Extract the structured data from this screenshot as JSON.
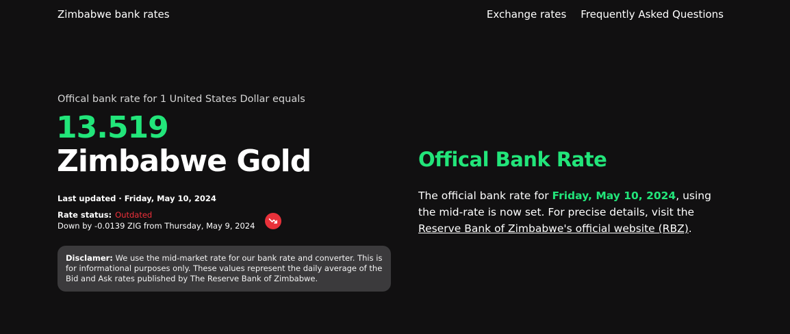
{
  "header": {
    "brand": "Zimbabwe bank rates",
    "nav": [
      {
        "label": "Exchange rates"
      },
      {
        "label": "Frequently Asked Questions"
      }
    ]
  },
  "hero": {
    "lead": "Offical bank rate for 1 United States Dollar equals",
    "rate": "13.519",
    "currency": "Zimbabwe Gold",
    "updated_label": "Last updated · Friday, May 10, 2024",
    "status_label": "Rate status:",
    "status_value": "Outdated",
    "change_text": "Down by -0.0139 ZIG from Thursday, May 9, 2024",
    "trend_icon": "trend-down-icon",
    "colors": {
      "accent": "#22e57a",
      "alert": "#e8313a",
      "background": "#111011",
      "panel": "#3b3a3c"
    }
  },
  "disclaimer": {
    "label": "Disclamer:",
    "text": " We use the mid-market rate for our bank rate and converter. This is for informational purposes only. These values represent the daily average of the Bid and Ask rates published by The Reserve Bank of Zimbabwe."
  },
  "official": {
    "title": "Offical Bank Rate",
    "body_pre": "The official bank rate for ",
    "body_date": "Friday, May 10, 2024",
    "body_mid": ", using the mid-rate is now set. For precise details, visit the ",
    "link_label": "Reserve Bank of Zimbabwe's official website (RBZ)",
    "body_post": "."
  }
}
